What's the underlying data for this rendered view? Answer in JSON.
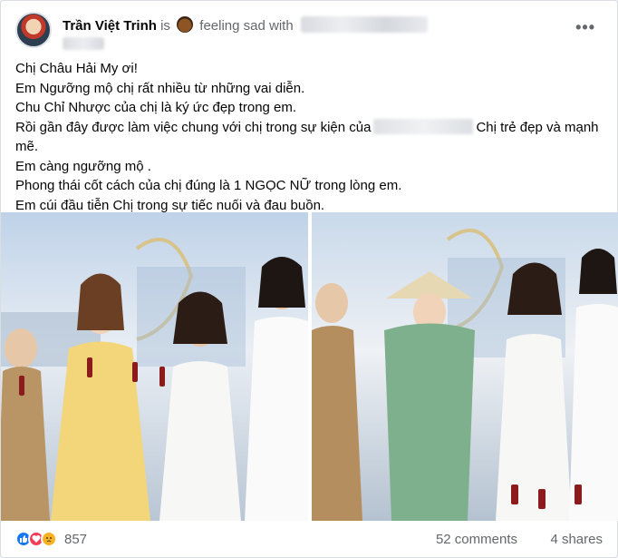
{
  "header": {
    "author": "Trần Việt Trinh",
    "is_word": "is",
    "feeling_text": "feeling sad with",
    "more_icon": "more-horizontal-icon"
  },
  "post": {
    "lines": [
      "Chị Châu Hải My ơi!",
      "Em Ngưỡng mộ chị rất nhiều từ những vai diễn.",
      "Chu Chỉ Nhược của chị là ký ức đẹp trong em.",
      "Rồi gần đây được làm việc chung với chị trong sự kiện của",
      "Chị trẻ đẹp và mạnh mẽ.",
      "Em càng ngưỡng mộ .",
      "Phong thái cốt cách của chị đúng là 1 NGỌC NỮ trong lòng em.",
      "Em cúi đầu tiễn Chị trong sự tiếc nuối và đau buồn."
    ]
  },
  "footer": {
    "reaction_icons": [
      "like-icon",
      "love-icon",
      "sad-icon"
    ],
    "reaction_count": "857",
    "comments": "52 comments",
    "shares": "4 shares"
  },
  "colors": {
    "brand": "#1877f2",
    "secondary_text": "#65676b",
    "love": "#f33e58",
    "sad": "#f7b125"
  }
}
